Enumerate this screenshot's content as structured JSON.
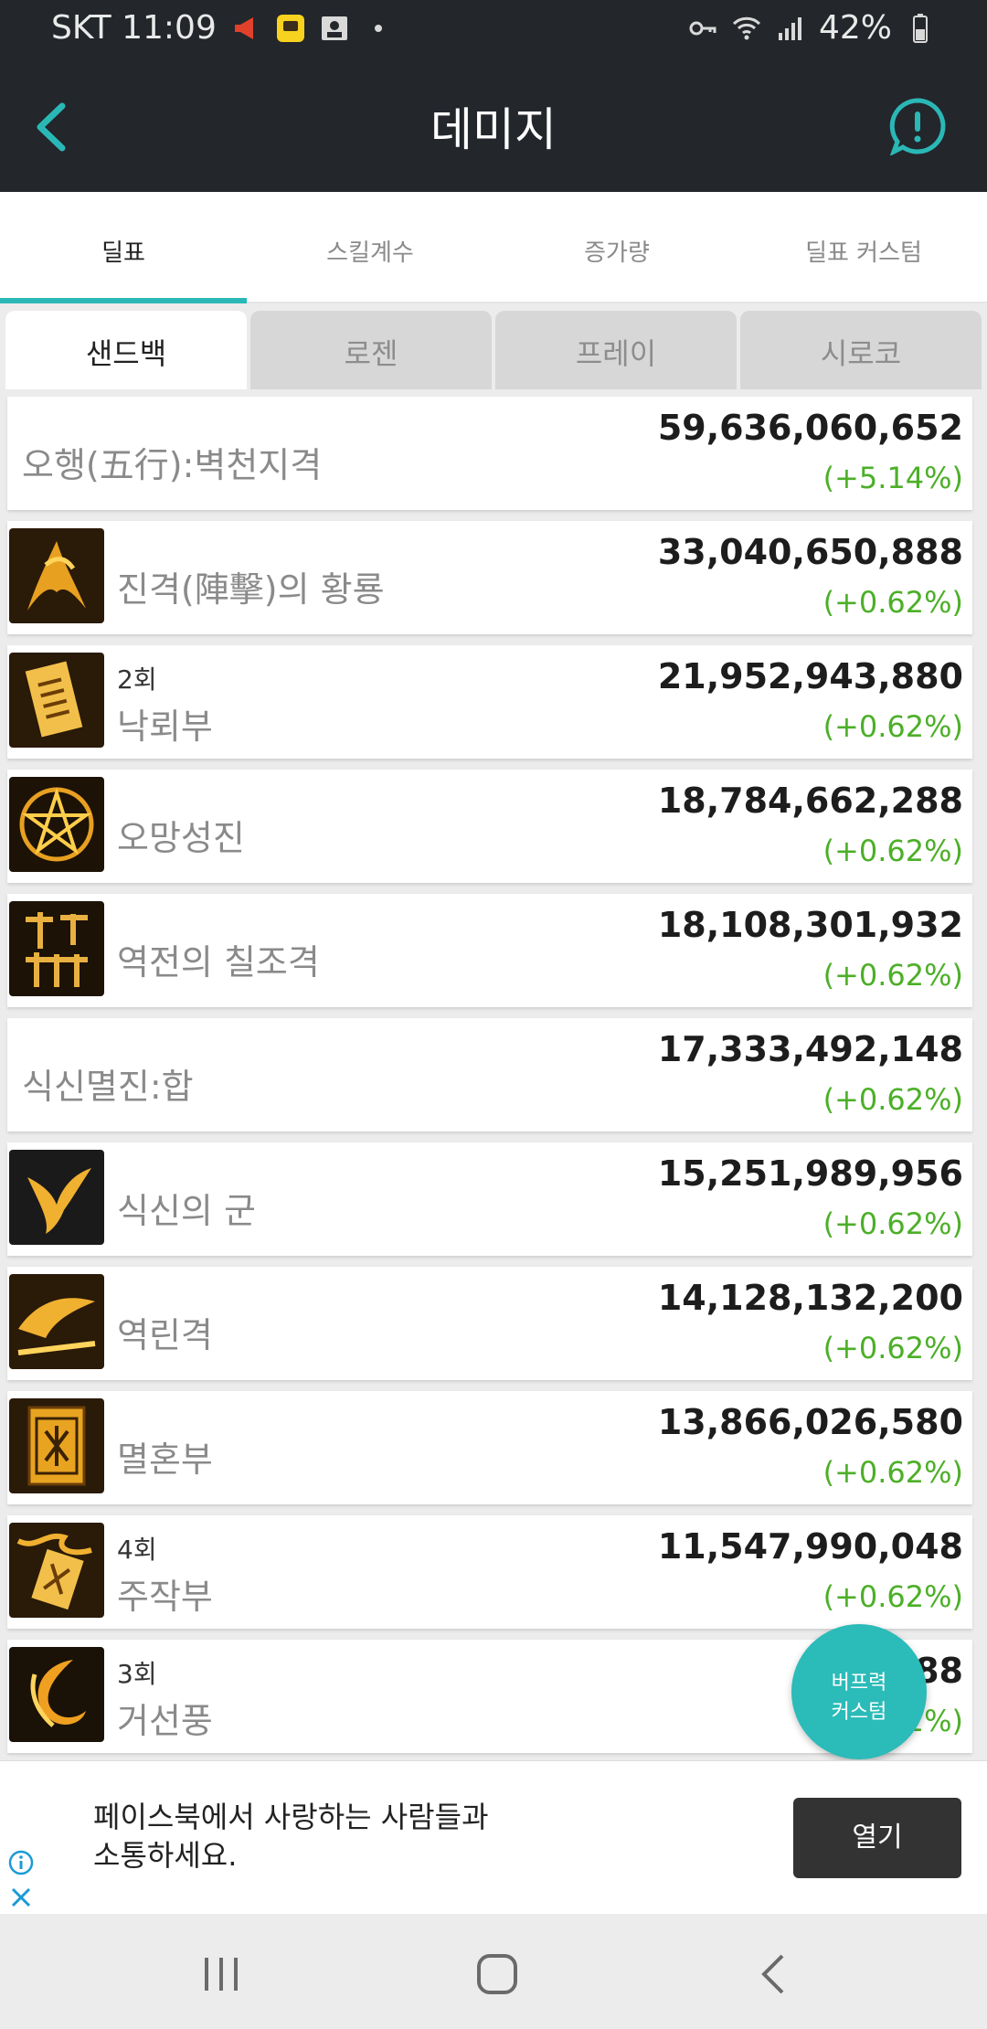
{
  "status": {
    "time_carrier": "SKT 11:09",
    "battery": "42%",
    "icons": [
      "megaphone-icon",
      "chat-app-icon",
      "contact-card-icon",
      "dot-icon",
      "key-icon",
      "wifi-icon",
      "signal-icon",
      "battery-icon"
    ]
  },
  "appbar": {
    "title": "데미지",
    "back_icon": "chevron-left-icon",
    "alert_icon": "exclamation-bubble-icon"
  },
  "tabs": [
    {
      "label": "딜표",
      "active": true
    },
    {
      "label": "스킬계수",
      "active": false
    },
    {
      "label": "증가량",
      "active": false
    },
    {
      "label": "딜표 커스텀",
      "active": false
    }
  ],
  "subtabs": [
    {
      "label": "샌드백",
      "active": true
    },
    {
      "label": "로젠",
      "active": false
    },
    {
      "label": "프레이",
      "active": false
    },
    {
      "label": "시로코",
      "active": false
    }
  ],
  "rows": [
    {
      "name": "오행(五行):벽천지격",
      "count": "",
      "value": "59,636,060,652",
      "pct": "(+5.14%)",
      "has_icon": false
    },
    {
      "name": "진격(陣擊)의 황룡",
      "count": "",
      "value": "33,040,650,888",
      "pct": "(+0.62%)",
      "has_icon": true
    },
    {
      "name": "낙뢰부",
      "count": "2회",
      "value": "21,952,943,880",
      "pct": "(+0.62%)",
      "has_icon": true
    },
    {
      "name": "오망성진",
      "count": "",
      "value": "18,784,662,288",
      "pct": "(+0.62%)",
      "has_icon": true
    },
    {
      "name": "역전의 칠조격",
      "count": "",
      "value": "18,108,301,932",
      "pct": "(+0.62%)",
      "has_icon": true
    },
    {
      "name": "식신멸진:합",
      "count": "",
      "value": "17,333,492,148",
      "pct": "(+0.62%)",
      "has_icon": false
    },
    {
      "name": "식신의 군",
      "count": "",
      "value": "15,251,989,956",
      "pct": "(+0.62%)",
      "has_icon": true
    },
    {
      "name": "역린격",
      "count": "",
      "value": "14,128,132,200",
      "pct": "(+0.62%)",
      "has_icon": true
    },
    {
      "name": "멸혼부",
      "count": "",
      "value": "13,866,026,580",
      "pct": "(+0.62%)",
      "has_icon": true
    },
    {
      "name": "주작부",
      "count": "4회",
      "value": "11,547,990,048",
      "pct": "(+0.62%)",
      "has_icon": true
    },
    {
      "name": "거선풍",
      "count": "3회",
      "value": "9,25   88",
      "pct": "2%)",
      "has_icon": true
    }
  ],
  "fab": {
    "line1": "버프력",
    "line2": "커스텀"
  },
  "ad": {
    "text_line1": "페이스북에서 사랑하는 사람들과",
    "text_line2": "소통하세요.",
    "button": "열기"
  },
  "colors": {
    "accent": "#2ab8b6",
    "appbar": "#23262b",
    "positive": "#4caf28"
  }
}
